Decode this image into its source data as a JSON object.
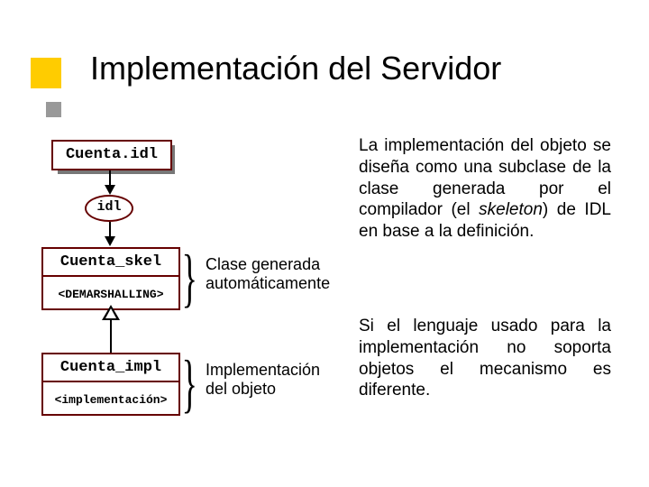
{
  "title": "Implementación del Servidor",
  "boxes": {
    "idlFile": "Cuenta.idl",
    "skelName": "Cuenta_skel",
    "skelSub": "<DEMARSHALLING>",
    "implName": "Cuenta_impl",
    "implSub": "<implementación>"
  },
  "ovalLabel": "idl",
  "labels": {
    "generated1": "Clase generada",
    "generated2": "automáticamente",
    "impl1": "Implementación",
    "impl2": "del objeto"
  },
  "para1_a": "La implementación del objeto se diseña como una subclase de la clase generada por el compilador (el ",
  "para1_it": "skeleton",
  "para1_b": ") de IDL en base a la definición.",
  "para2": "Si el lenguaje usado para la implementación no soporta objetos el mecanismo es diferente."
}
